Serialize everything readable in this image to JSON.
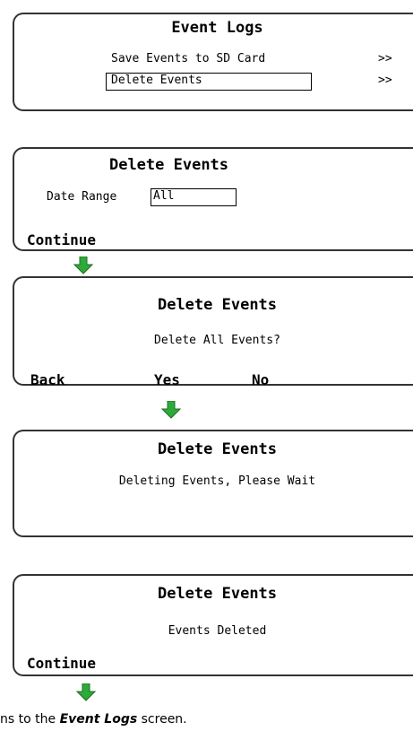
{
  "screen1": {
    "title": "Event Logs",
    "items": [
      {
        "label": "Save Events to SD Card",
        "chevron": ">>"
      },
      {
        "label": "Delete Events",
        "chevron": ">>"
      }
    ]
  },
  "screen2": {
    "title": "Delete Events",
    "date_range_label": "Date Range",
    "date_range_value": "All",
    "softkey_continue": "Continue"
  },
  "screen3": {
    "title": "Delete Events",
    "message": "Delete All Events?",
    "softkey_back": "Back",
    "softkey_yes": "Yes",
    "softkey_no": "No"
  },
  "screen4": {
    "title": "Delete Events",
    "message": "Deleting Events, Please Wait"
  },
  "screen5": {
    "title": "Delete Events",
    "message": "Events Deleted",
    "softkey_continue": "Continue"
  },
  "caption": {
    "prefix": "ns to the ",
    "emphasis": "Event Logs",
    "suffix": " screen."
  },
  "arrow_color": "#2eaa3a"
}
